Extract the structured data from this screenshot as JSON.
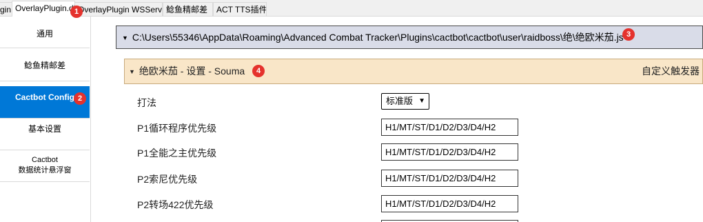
{
  "tabs": [
    {
      "label": "gin"
    },
    {
      "label": "OverlayPlugin.dll"
    },
    {
      "label": "OverlayPlugin WSServer"
    },
    {
      "label": "鲶鱼精邮差"
    },
    {
      "label": "ACT TTS插件"
    }
  ],
  "sidebar": {
    "items": [
      {
        "label": "通用"
      },
      {
        "label": "鲶鱼精邮差"
      },
      {
        "label": "Cactbot Config"
      },
      {
        "label": "基本设置"
      },
      {
        "label_line1": "Cactbot",
        "label_line2": "数据统计悬浮窗"
      }
    ]
  },
  "path_header": {
    "text": "C:\\Users\\55346\\AppData\\Roaming\\Advanced Combat Tracker\\Plugins\\cactbot\\cactbot\\user\\raidboss\\绝\\绝欧米茄.js"
  },
  "settings_header": {
    "title": "绝欧米茄 - 设置 - Souma",
    "right_label": "自定义触发器"
  },
  "strategy": {
    "label": "打法",
    "selected": "标准版"
  },
  "fields": [
    {
      "label": "P1循环程序优先级",
      "value": "H1/MT/ST/D1/D2/D3/D4/H2"
    },
    {
      "label": "P1全能之主优先级",
      "value": "H1/MT/ST/D1/D2/D3/D4/H2"
    },
    {
      "label": "P2索尼优先级",
      "value": "H1/MT/ST/D1/D2/D3/D4/H2"
    },
    {
      "label": "P2转场422优先级",
      "value": "H1/MT/ST/D1/D2/D3/D4/H2"
    }
  ],
  "badges": [
    "1",
    "2",
    "3",
    "4"
  ],
  "colors": {
    "selected_nav": "#0078d7",
    "path_bar": "#d9dce8",
    "settings_bar": "#f9e6c8",
    "badge": "#e5322d"
  }
}
